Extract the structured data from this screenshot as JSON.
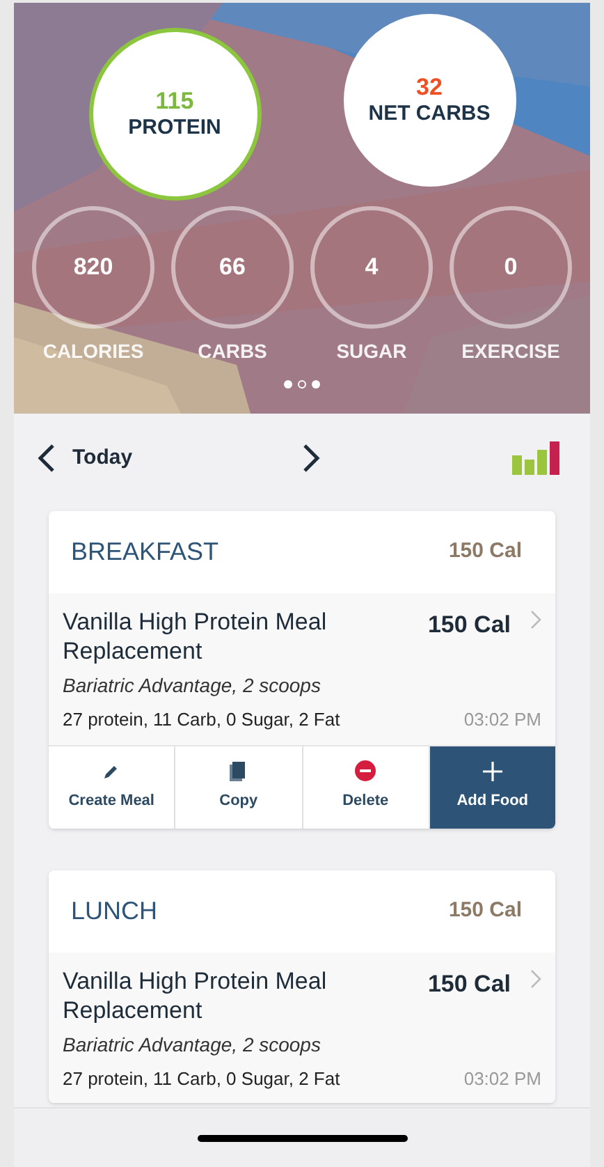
{
  "goals": [
    {
      "value": "115",
      "label": "PROTEIN",
      "kind": "ring"
    },
    {
      "value": "32",
      "label": "NET CARBS",
      "kind": "plain"
    }
  ],
  "stats": [
    {
      "value": "820",
      "label": "CALORIES"
    },
    {
      "value": "66",
      "label": "CARBS"
    },
    {
      "value": "4",
      "label": "SUGAR"
    },
    {
      "value": "0",
      "label": "EXERCISE"
    }
  ],
  "page_dots": [
    {
      "selected": false
    },
    {
      "selected": true
    },
    {
      "selected": false
    }
  ],
  "date_nav": {
    "label": "Today"
  },
  "meals": [
    {
      "title": "BREAKFAST",
      "calories": "150 Cal",
      "items": [
        {
          "name": "Vanilla High Protein Meal Replacement",
          "calories": "150 Cal",
          "detail": "Bariatric Advantage, 2 scoops",
          "macros": "27 protein, 11 Carb, 0 Sugar, 2 Fat",
          "time": "03:02 PM"
        }
      ],
      "actions": [
        {
          "kind": "create",
          "label": "Create Meal"
        },
        {
          "kind": "copy",
          "label": "Copy"
        },
        {
          "kind": "delete",
          "label": "Delete"
        },
        {
          "kind": "add",
          "label": "Add Food"
        }
      ]
    },
    {
      "title": "LUNCH",
      "calories": "150 Cal",
      "items": [
        {
          "name": "Vanilla High Protein Meal Replacement",
          "calories": "150 Cal",
          "detail": "Bariatric Advantage, 2 scoops",
          "macros": "27 protein, 11 Carb, 0 Sugar, 2 Fat",
          "time": "03:02 PM"
        }
      ]
    }
  ]
}
